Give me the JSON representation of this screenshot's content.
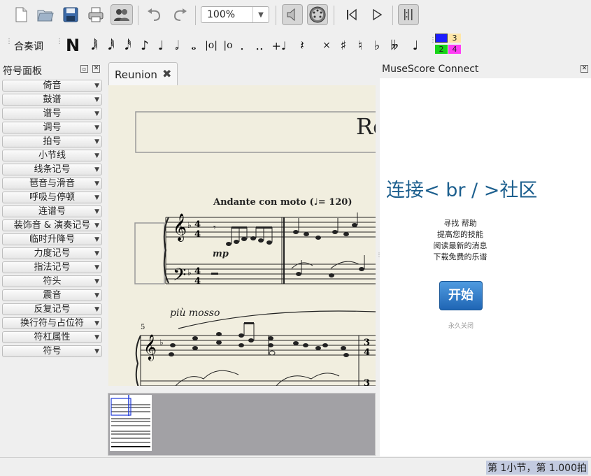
{
  "toolbar": {
    "zoom_value": "100%"
  },
  "note_input": {
    "mode_label": "合奏调",
    "voice_numbers": [
      "3",
      "2",
      "4"
    ],
    "voice_colors": {
      "v1": "#1d1dff",
      "v3": "#ffe6a8",
      "v2": "#18d418",
      "v4": "#ff3df5"
    }
  },
  "palette": {
    "title": "符号面板",
    "items": [
      "倚音",
      "鼓谱",
      "谱号",
      "调号",
      "拍号",
      "小节线",
      "线条记号",
      "琶音与滑音",
      "呼吸与停顿",
      "连谱号",
      "装饰音 & 演奏记号",
      "临时升降号",
      "力度记号",
      "指法记号",
      "符头",
      "震音",
      "反复记号",
      "换行符与占位符",
      "符杠属性",
      "符号"
    ]
  },
  "score": {
    "tab_label": "Reunion",
    "title_partial": "Re",
    "tempo_text": "Andante con moto (",
    "tempo_value": "= 120)",
    "dynamic": "mp",
    "expression": "più mosso",
    "measure_number": "5"
  },
  "connect": {
    "title": "MuseScore Connect",
    "heading": "连接< br / >社区",
    "lines": [
      "寻找 帮助",
      "提高您的技能",
      "阅读最新的消息",
      "下载免费的乐谱"
    ],
    "start_button": "开始",
    "dismiss_link": "永久关闭"
  },
  "status": {
    "position_text": "第  1小节，第 1.000拍"
  }
}
